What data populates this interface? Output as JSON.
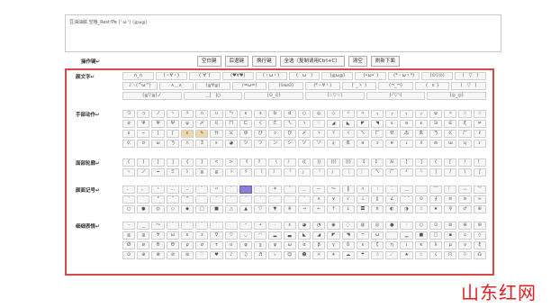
{
  "editor": {
    "content": "豆油油腻 空格_Rest!Pe (' ω ') (≧ω≦)"
  },
  "toolbar": {
    "label": "操作键↵",
    "buttons": [
      "空白键",
      "后退键",
      "换行键",
      "全选（复制请用Ctrl+C）",
      "清空",
      "刷新下面"
    ]
  },
  "categories": [
    {
      "label": "颜文字↵",
      "rows": [
        {
          "wide": true,
          "keys": [
            "∩_∩",
            "(・∀・)",
            "(´∀`)",
            "(♥∀♥)",
            "(・ω・)",
            "(￣ω￣)",
            "(≧ω≦)",
            "(•ω•`)",
            "(*・ω・*)",
            "(⊙▽⊙)",
            "(￣▽￣)"
          ]
        },
        {
          "wide": true,
          "keys": [
            "♪＼(^ω^)",
            "∧＿∧",
            "(≧∀≦)",
            "(=ω=)",
            "(⊙ω⊙)",
            "(*・∀・)",
            "(´_ゝ`)",
            "(¬_¬)",
            "(｀ε´)",
            "(＾▽＾)"
          ]
        },
        {
          "wide": true,
          "keys": [
            "(≧▽≦)ノ",
            "＿|￣|○",
            "(⊙_⊙)",
            "(☆▽☆)",
            "(╯▽╰)",
            "(◎_◎)"
          ]
        }
      ]
    },
    {
      "label": "手部动作↵",
      "rows": [
        {
          "wide": false,
          "keys": [
            "つ",
            "っ",
            "ノ",
            "ヽ",
            "ゞ",
            "∩",
            "∪",
            "ㄣ",
            "ε",
            "з",
            "b",
            "d",
            "○",
            "◎",
            "◇",
            "ヾ",
            "〃",
            "┐",
            "┌",
            "╮",
            "╭",
            "ψ",
            "✧",
            "☆",
            "☆"
          ]
        },
        {
          "wide": false,
          "keys": [
            "σ",
            "Ψ",
            "Ψ",
            "Ψ",
            "ψ",
            "〆",
            "ㄍ",
            "ㄇ",
            "ㄈ",
            "ㄑ",
            "ㄜ",
            "ㄟ",
            "ゝ",
            "♡",
            "◢",
            "◣",
            "◤",
            "◥",
            "ε",
            "ə",
            "ε",
            "∋",
            "∈",
            "ξ",
            "≠"
          ]
        },
        {
          "wide": false,
          "keys": [
            "ɛ",
            "∽",
            "ɭ",
            "ʃ",
            "ɛ",
            "✎",
            "卄",
            "乂",
            "ゆ",
            "び",
            "ッ",
            "ぴ",
            "〆",
            "ゝ",
            "ゞ",
            "ヾ",
            "ㄟ",
            "ㄏ",
            "ㄝ",
            "ゐ",
            "ゑ",
            "ㄋ",
            "ㄍ",
            "ㄏ",
            "ℓ"
          ]
        },
        {
          "wide": false,
          "keys": [
            "ㄍ",
            "σ",
            "ω",
            "ㄋ",
            "∩",
            "3",
            "ɛ",
            "◕",
            "ヅ",
            "ツ",
            "ン",
            "シ",
            "ソ",
            "ゾ",
            "ぇ",
            "ゑ",
            "ǝ",
            "ɔ",
            "ɐ",
            "ɹ",
            "ʎ",
            "ʍ",
            "ɯ",
            "ɥ",
            "ɾ"
          ]
        }
      ]
    },
    {
      "label": "面部轮廓↵",
      "rows": [
        {
          "wide": false,
          "keys": [
            "(",
            ")",
            "[",
            "]",
            "{",
            "}",
            "<",
            ">",
            "《",
            "》",
            "〈",
            "〉",
            "((",
            "))",
            "(((",
            ")))",
            "【",
            "】",
            "从",
            "[",
            "]",
            "(",
            "[",
            "!",
            "！"
          ]
        },
        {
          "wide": false,
          "keys": [
            "ヽ",
            "ノ",
            "━",
            "ミ",
            "ｼ",
            "≦",
            "≧",
            "ゝ",
            "ゞ",
            "〔",
            "〕",
            "「",
            "」",
            "『",
            "』",
            "〖",
            "〗",
            "ㄟ",
            "ㄏ",
            "┘",
            "└",
            "|",
            "/",
            "\\",
            "∫"
          ]
        }
      ]
    },
    {
      "label": "颜面记号↵",
      "rows": [
        {
          "wide": false,
          "keys": [
            "、",
            "。",
            "・",
            "…",
            "‥",
            "¨",
            "〃",
            "′",
            "″",
            "‵",
            "＊",
            "¯",
            "＿",
            "—",
            "〜",
            "‖",
            "〃",
            "∶",
            "︰",
            "﹏",
            "﹋",
            "﹌",
            "︴",
            "︿",
            "﹀"
          ]
        },
        {
          "wide": false,
          "keys": [
            "'",
            "`",
            "°",
            "＂",
            "^",
            "￣",
            "ˉ",
            "ˇ",
            "˘",
            "˙",
            "ˊ",
            "ˋ",
            "ˆ",
            "∧",
            "∨",
            "√",
            "⊥",
            "∥",
            "∠",
            "⌒",
            "⊙",
            "∮",
            "≡",
            "≌",
            "≈"
          ]
        },
        {
          "wide": false,
          "keys": [
            "○",
            "●",
            "◎",
            "◇",
            "◆",
            "□",
            "■",
            "△",
            "▲",
            "▽",
            "▼",
            "※",
            "→",
            "←",
            "↑",
            "↓",
            "〓",
            "¤",
            "◐",
            "◑",
            "☆",
            "★",
            "♀",
            "♂",
            "⊕"
          ]
        }
      ]
    },
    {
      "label": "细细表情↵",
      "rows": [
        {
          "wide": false,
          "keys": [
            "-",
            "_",
            "～",
            "˙",
            "ˇ",
            "`",
            "´",
            "＾",
            "﹡",
            "•",
            "·",
            "ε",
            "◕",
            "◔",
            "◉",
            "◌",
            "◍",
            "◎",
            "●",
            "◦",
            "○",
            "⊙",
            "⊚",
            "⊛",
            "⊜"
          ]
        },
        {
          "wide": false,
          "keys": [
            "≧",
            "≦",
            "∀",
            "ω",
            "ε",
            "з",
            "∇",
            "▽",
            "◡",
            "◠",
            "▂",
            "▃",
            "◣",
            "◢",
            "◤",
            "◥",
            "ㄧ",
            "ω",
            "▔",
            "▁",
            "■",
            "□",
            "▪",
            "▫",
            "◊"
          ]
        },
        {
          "wide": false,
          "keys": [
            "Ø",
            "ø",
            "θ",
            "Θ",
            "ρ",
            "σ",
            "τ",
            "υ",
            "φ",
            "χ",
            "ψ",
            "ω",
            "α",
            "β",
            "γ",
            "δ",
            "ε",
            "ζ",
            "η",
            "ι",
            "κ",
            "λ",
            "μ",
            "ν",
            "ξ"
          ]
        },
        {
          "wide": false,
          "keys": [
            "⊙",
            "⊕",
            "⊗",
            "⊘",
            "⊚",
            "♡",
            "♥",
            "♪",
            "♫",
            "♬",
            "♭",
            "☺",
            "☻",
            "☼",
            "☀",
            "☁",
            "☂",
            "☃",
            "☄",
            "★",
            "☆",
            "☇",
            "☈",
            "☉",
            "☊"
          ]
        }
      ]
    }
  ],
  "watermark": "山东红网"
}
